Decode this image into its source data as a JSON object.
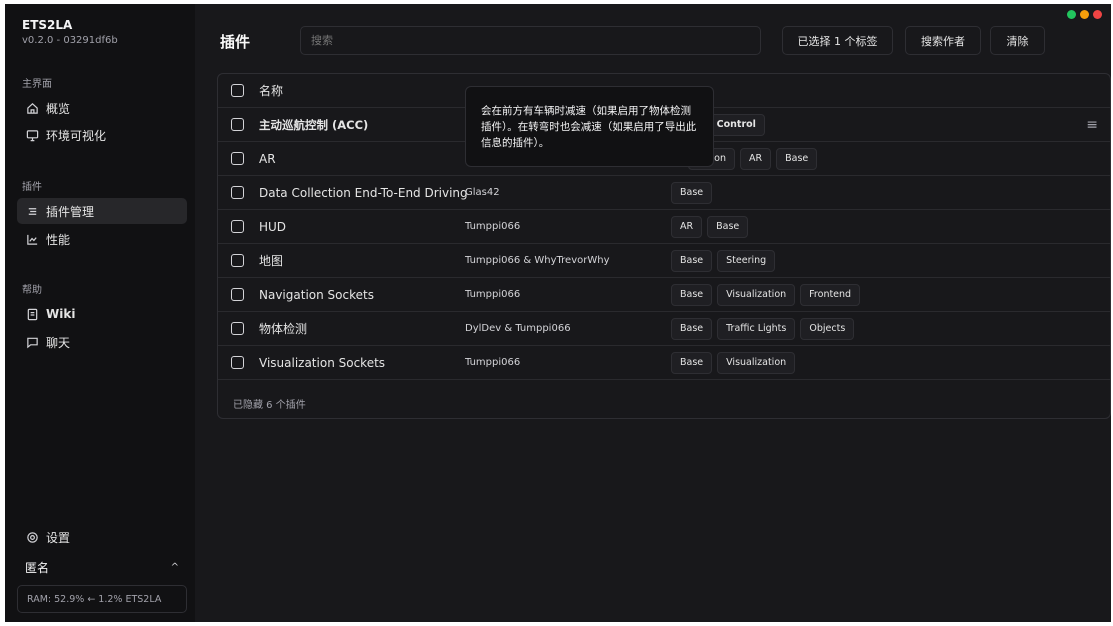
{
  "window": {
    "controls": [
      {
        "name": "minimize",
        "color": "#22c55e"
      },
      {
        "name": "maximize",
        "color": "#f59e0b"
      },
      {
        "name": "close",
        "color": "#ef4444"
      }
    ]
  },
  "sidebar": {
    "app_name": "ETS2LA",
    "version": "v0.2.0 - 03291df6b",
    "groups": [
      {
        "label": "主界面",
        "items": [
          {
            "label": "概览",
            "icon": "home-icon"
          },
          {
            "label": "环境可视化",
            "icon": "monitor-icon"
          }
        ]
      },
      {
        "label": "插件",
        "items": [
          {
            "label": "插件管理",
            "icon": "list-icon",
            "active": true
          },
          {
            "label": "性能",
            "icon": "chart-icon"
          }
        ]
      },
      {
        "label": "帮助",
        "items": [
          {
            "label": "Wiki",
            "icon": "book-icon"
          },
          {
            "label": "聊天",
            "icon": "chat-icon"
          }
        ]
      }
    ],
    "settings_label": "设置",
    "user_name": "匿名",
    "ram_status": "RAM: 52.9% ← 1.2% ETS2LA"
  },
  "header": {
    "title": "插件",
    "search_placeholder": "搜索",
    "tag_filter_label": "已选择 1 个标签",
    "author_search_label": "搜索作者",
    "clear_label": "清除"
  },
  "table": {
    "header_name": "名称",
    "rows": [
      {
        "name": "主动巡航控制 (ACC)",
        "author": "",
        "tags": [
          "Speed Control"
        ],
        "bold": true
      },
      {
        "name": "AR",
        "author": "",
        "tags": [
          "zation",
          "AR",
          "Base"
        ]
      },
      {
        "name": "Data Collection End-To-End Driving",
        "author": "Glas42",
        "tags": [
          "Base"
        ]
      },
      {
        "name": "HUD",
        "author": "Tumppi066",
        "tags": [
          "AR",
          "Base"
        ]
      },
      {
        "name": "地图",
        "author": "Tumppi066 & WhyTrevorWhy",
        "tags": [
          "Base",
          "Steering"
        ]
      },
      {
        "name": "Navigation Sockets",
        "author": "Tumppi066",
        "tags": [
          "Base",
          "Visualization",
          "Frontend"
        ]
      },
      {
        "name": "物体检测",
        "author": "DylDev & Tumppi066",
        "tags": [
          "Base",
          "Traffic Lights",
          "Objects"
        ]
      },
      {
        "name": "Visualization Sockets",
        "author": "Tumppi066",
        "tags": [
          "Base",
          "Visualization"
        ]
      }
    ],
    "hidden_note": "已隐藏 6 个插件"
  },
  "tooltip": {
    "text": "会在前方有车辆时减速（如果启用了物体检测插件）。在转弯时也会减速（如果启用了导出此信息的插件）。"
  }
}
